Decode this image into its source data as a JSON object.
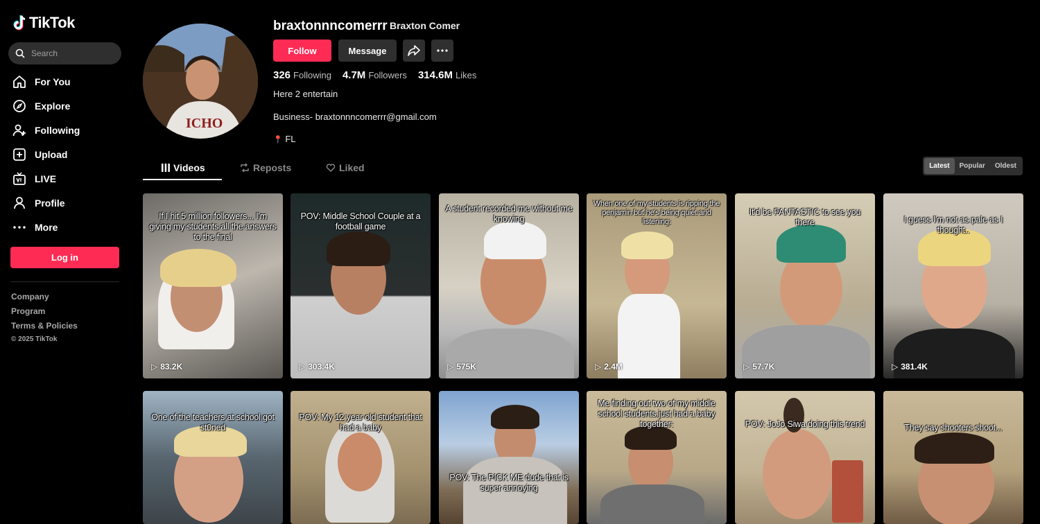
{
  "app": {
    "name": "TikTok"
  },
  "search": {
    "placeholder": "Search"
  },
  "nav": [
    {
      "label": "For You",
      "icon": "home-icon"
    },
    {
      "label": "Explore",
      "icon": "compass-icon"
    },
    {
      "label": "Following",
      "icon": "user-plus-icon"
    },
    {
      "label": "Upload",
      "icon": "plus-square-icon"
    },
    {
      "label": "LIVE",
      "icon": "tv-icon"
    },
    {
      "label": "Profile",
      "icon": "person-icon"
    },
    {
      "label": "More",
      "icon": "ellipsis-icon"
    }
  ],
  "login_label": "Log in",
  "footer": {
    "links": [
      "Company",
      "Program",
      "Terms & Policies"
    ],
    "copyright": "© 2025 TikTok"
  },
  "profile": {
    "username": "braxtonnncomerrr",
    "nickname": "Braxton Comer",
    "follow_label": "Follow",
    "message_label": "Message",
    "stats": {
      "following": {
        "value": "326",
        "label": "Following"
      },
      "followers": {
        "value": "4.7M",
        "label": "Followers"
      },
      "likes": {
        "value": "314.6M",
        "label": "Likes"
      }
    },
    "bio_line1": "Here 2 entertain",
    "bio_line2": "Business- braxtonnncomerrr@gmail.com",
    "location": "FL"
  },
  "tabs": {
    "videos": "Videos",
    "reposts": "Reposts",
    "liked": "Liked"
  },
  "sort": {
    "latest": "Latest",
    "popular": "Popular",
    "oldest": "Oldest"
  },
  "videos": [
    {
      "caption": "If I hit 5 million followers... I'm giving my students all the answers to the final",
      "views": "83.2K"
    },
    {
      "caption": "POV: Middle School Couple at a football game",
      "views": "303.4K"
    },
    {
      "caption": "A student recorded me without me knowing",
      "views": "575K"
    },
    {
      "caption": "When one of my students is ripping the penjamin but he's being quiet and listening:",
      "views": "2.4M"
    },
    {
      "caption": "It'd be FANTASTIC to see you there",
      "views": "57.7K"
    },
    {
      "caption": "I guess I'm not as pale as I thought..",
      "views": "381.4K"
    },
    {
      "caption": "One of the teachers at school got st0ned",
      "views": ""
    },
    {
      "caption": "POV: My 12 year old student that had a baby",
      "views": ""
    },
    {
      "caption": "POV: The PICK ME dude that is super annoying",
      "views": ""
    },
    {
      "caption": "Me finding out two of my middle school students just had a baby together:",
      "views": ""
    },
    {
      "caption": "POV: JoJo Siwa doing this trend",
      "views": ""
    },
    {
      "caption": "They say shooters shoot...",
      "views": ""
    }
  ],
  "colors": {
    "accent": "#fe2c55",
    "background": "#000000",
    "button_gray": "#2f2f2f"
  }
}
